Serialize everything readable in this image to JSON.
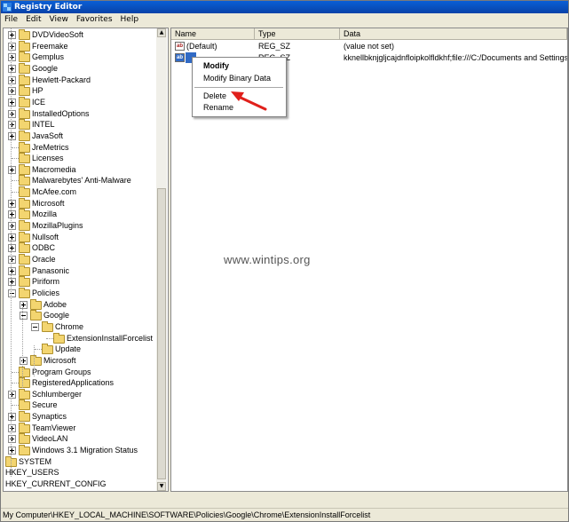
{
  "window": {
    "title": "Registry Editor"
  },
  "menu": [
    "File",
    "Edit",
    "View",
    "Favorites",
    "Help"
  ],
  "tree": {
    "items": [
      {
        "label": "DVDVideoSoft",
        "level": 1,
        "expander": "plus"
      },
      {
        "label": "Freemake",
        "level": 1,
        "expander": "plus"
      },
      {
        "label": "Gemplus",
        "level": 1,
        "expander": "plus"
      },
      {
        "label": "Google",
        "level": 1,
        "expander": "plus"
      },
      {
        "label": "Hewlett-Packard",
        "level": 1,
        "expander": "plus"
      },
      {
        "label": "HP",
        "level": 1,
        "expander": "plus"
      },
      {
        "label": "ICE",
        "level": 1,
        "expander": "plus"
      },
      {
        "label": "InstalledOptions",
        "level": 1,
        "expander": "plus"
      },
      {
        "label": "INTEL",
        "level": 1,
        "expander": "plus"
      },
      {
        "label": "JavaSoft",
        "level": 1,
        "expander": "plus"
      },
      {
        "label": "JreMetrics",
        "level": 1,
        "expander": "none"
      },
      {
        "label": "Licenses",
        "level": 1,
        "expander": "none"
      },
      {
        "label": "Macromedia",
        "level": 1,
        "expander": "plus"
      },
      {
        "label": "Malwarebytes' Anti-Malware",
        "level": 1,
        "expander": "none"
      },
      {
        "label": "McAfee.com",
        "level": 1,
        "expander": "none"
      },
      {
        "label": "Microsoft",
        "level": 1,
        "expander": "plus"
      },
      {
        "label": "Mozilla",
        "level": 1,
        "expander": "plus"
      },
      {
        "label": "MozillaPlugins",
        "level": 1,
        "expander": "plus"
      },
      {
        "label": "Nullsoft",
        "level": 1,
        "expander": "plus"
      },
      {
        "label": "ODBC",
        "level": 1,
        "expander": "plus"
      },
      {
        "label": "Oracle",
        "level": 1,
        "expander": "plus"
      },
      {
        "label": "Panasonic",
        "level": 1,
        "expander": "plus"
      },
      {
        "label": "Piriform",
        "level": 1,
        "expander": "plus"
      },
      {
        "label": "Policies",
        "level": 1,
        "expander": "minus"
      },
      {
        "label": "Adobe",
        "level": 2,
        "expander": "plus"
      },
      {
        "label": "Google",
        "level": 2,
        "expander": "minus"
      },
      {
        "label": "Chrome",
        "level": 3,
        "expander": "minus"
      },
      {
        "label": "ExtensionInstallForcelist",
        "level": 4,
        "expander": "none",
        "open": true
      },
      {
        "label": "Update",
        "level": 3,
        "expander": "none"
      },
      {
        "label": "Microsoft",
        "level": 2,
        "expander": "plus"
      },
      {
        "label": "Program Groups",
        "level": 1,
        "expander": "none"
      },
      {
        "label": "RegisteredApplications",
        "level": 1,
        "expander": "none"
      },
      {
        "label": "Schlumberger",
        "level": 1,
        "expander": "plus"
      },
      {
        "label": "Secure",
        "level": 1,
        "expander": "none"
      },
      {
        "label": "Synaptics",
        "level": 1,
        "expander": "plus"
      },
      {
        "label": "TeamViewer",
        "level": 1,
        "expander": "plus"
      },
      {
        "label": "VideoLAN",
        "level": 1,
        "expander": "plus"
      },
      {
        "label": "Windows 3.1 Migration Status",
        "level": 1,
        "expander": "plus"
      },
      {
        "label": "SYSTEM",
        "level": 0,
        "expander": "none"
      },
      {
        "label": "HKEY_USERS",
        "level": -1,
        "expander": "none"
      },
      {
        "label": "HKEY_CURRENT_CONFIG",
        "level": -1,
        "expander": "none"
      }
    ]
  },
  "list": {
    "columns": [
      "Name",
      "Type",
      "Data"
    ],
    "rows": [
      {
        "name": "(Default)",
        "type": "REG_SZ",
        "data": "(value not set)",
        "icon": "string-value-icon"
      },
      {
        "name": "1",
        "type": "REG_SZ",
        "data": "kknellbknjgljcajdnfloipkolfldkhf;file:///C:/Documents and Settings/Ad",
        "icon": "string-value-icon",
        "selected": true
      }
    ]
  },
  "context_menu": {
    "items": [
      "Modify",
      "Modify Binary Data",
      "Delete",
      "Rename"
    ]
  },
  "watermark": "www.wintips.org",
  "status": {
    "path": "My Computer\\HKEY_LOCAL_MACHINE\\SOFTWARE\\Policies\\Google\\Chrome\\ExtensionInstallForcelist"
  },
  "colors": {
    "selection": "#316ac5",
    "arrow": "#e0201b",
    "title": "#0a5fd6"
  }
}
